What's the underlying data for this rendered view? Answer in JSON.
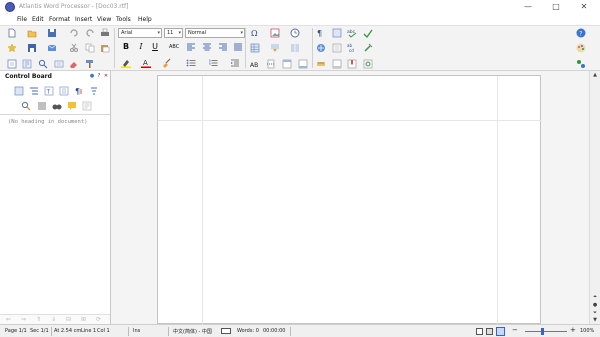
{
  "window": {
    "title": "Atlantis Word Processor - [Doc03.rtf]",
    "controls": {
      "minimize": "—",
      "maximize": "□",
      "close": "✕"
    }
  },
  "menu": {
    "items": [
      "File",
      "Edit",
      "Format",
      "Insert",
      "View",
      "Tools",
      "Help"
    ]
  },
  "toolbar": {
    "font_name": "Arial",
    "font_size": "11",
    "style": "Normal",
    "bold": "B",
    "italic": "I",
    "underline": "U",
    "abc_label": "ABC",
    "spelling_label": "AB",
    "icons": [
      "new-document-icon",
      "open-folder-icon",
      "save-icon",
      "undo-icon",
      "redo-icon",
      "print-icon",
      "favorites-icon",
      "save-as-icon",
      "email-icon",
      "cut-icon",
      "copy-icon",
      "paste-icon",
      "page-view-icon",
      "document-properties-icon",
      "find-icon",
      "eraser-icon",
      "format-painter-icon",
      "symbol-icon",
      "text-box-icon",
      "bullet-icon",
      "paragraph-marks-icon",
      "navigate-icon",
      "spell-check-icon",
      "autocorrect-icon",
      "help-icon",
      "palette-icon",
      "tools-icon"
    ],
    "colors": {
      "highlight": "#ffe100",
      "font_color": "#d40000"
    }
  },
  "control_board": {
    "title": "Control Board",
    "controls": {
      "help": "?",
      "close": "✕"
    },
    "empty_message": "(No heading in document)"
  },
  "statusbar": {
    "page": "Page 1/1",
    "section": "Sec 1/1",
    "position": "At 2.54 cm",
    "line": "Line 1",
    "column": "Col 1",
    "mode": "Ins",
    "language": "中文(简体) - 中国",
    "words": "Words: 0",
    "time": "00:00:00",
    "zoom": "100%",
    "zoom_out": "−",
    "zoom_in": "+"
  }
}
